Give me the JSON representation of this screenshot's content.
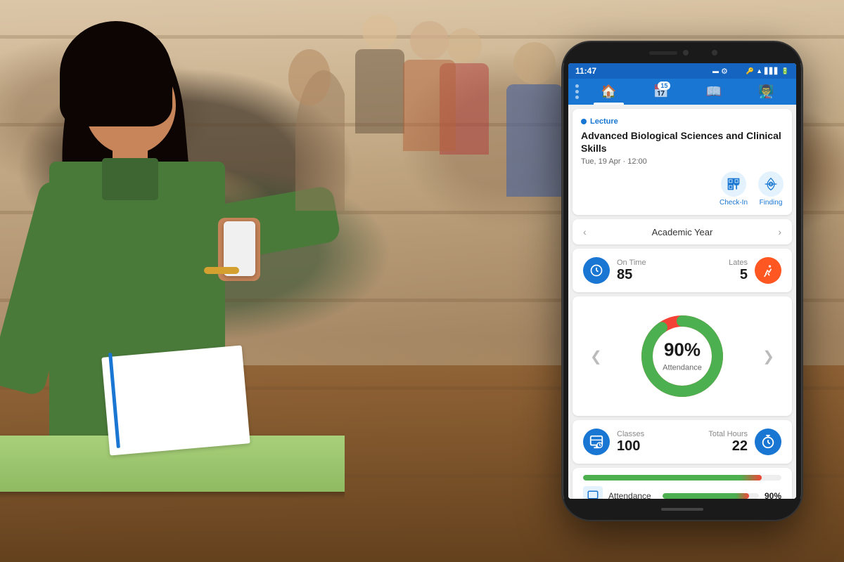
{
  "background": {
    "description": "Classroom with students"
  },
  "status_bar": {
    "time": "11:47",
    "icons": "⊟ ✦ ⊡ ▲ ▋"
  },
  "nav": {
    "items": [
      {
        "id": "home",
        "icon": "🏠",
        "active": true
      },
      {
        "id": "calendar",
        "icon": "📅",
        "badge": "15",
        "active": false
      },
      {
        "id": "book",
        "icon": "📖",
        "active": false
      },
      {
        "id": "teacher",
        "icon": "👨‍🏫",
        "active": false
      }
    ]
  },
  "lecture_card": {
    "type_label": "Lecture",
    "title": "Advanced Biological Sciences and Clinical Skills",
    "datetime": "Tue, 19 Apr · 12:00",
    "actions": [
      {
        "id": "checkin",
        "label": "Check-In",
        "icon": "⚏"
      },
      {
        "id": "finding",
        "label": "Finding",
        "icon": "📡"
      }
    ]
  },
  "year_selector": {
    "label": "Academic Year",
    "left_arrow": "‹",
    "right_arrow": "›"
  },
  "stats": {
    "on_time_label": "On Time",
    "on_time_value": "85",
    "lates_label": "Lates",
    "lates_value": "5"
  },
  "attendance_chart": {
    "percentage": "90%",
    "label": "Attendance",
    "left_arrow": "❮",
    "right_arrow": "❯",
    "green_percent": 90,
    "red_percent": 10
  },
  "bottom_stats": {
    "classes_label": "Classes",
    "classes_value": "100",
    "total_hours_label": "Total Hours",
    "total_hours_value": "22"
  },
  "progress_bar": {
    "label": "Attendance",
    "value": "90%",
    "fill_percent": 90
  },
  "colors": {
    "primary": "#1976d2",
    "accent_blue": "#1565c0",
    "green": "#4caf50",
    "red": "#f44336",
    "orange": "#ff5722"
  }
}
